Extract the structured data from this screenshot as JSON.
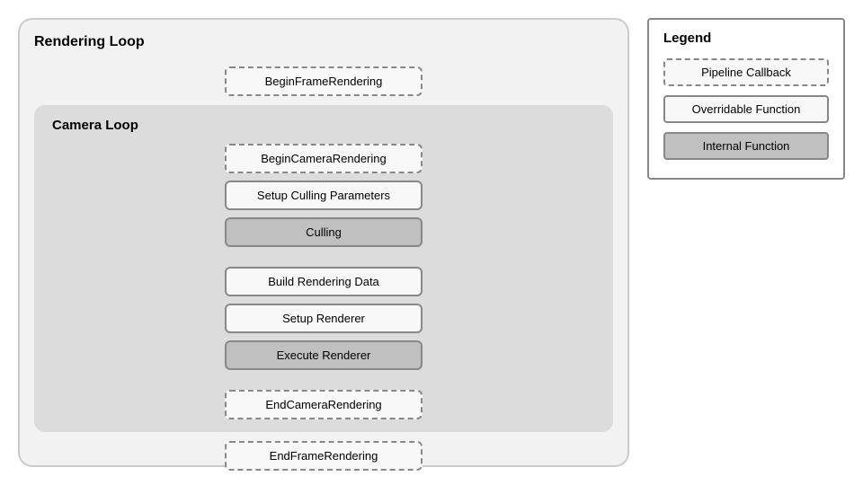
{
  "rendering_loop": {
    "title": "Rendering Loop",
    "begin_frame": "BeginFrameRendering",
    "end_frame": "EndFrameRendering"
  },
  "camera_loop": {
    "title": "Camera Loop",
    "begin_camera": "BeginCameraRendering",
    "setup_culling": "Setup Culling Parameters",
    "culling": "Culling",
    "build_rendering": "Build Rendering Data",
    "setup_renderer": "Setup Renderer",
    "execute_renderer": "Execute Renderer",
    "end_camera": "EndCameraRendering"
  },
  "legend": {
    "title": "Legend",
    "pipeline_callback": "Pipeline Callback",
    "overridable_function": "Overridable Function",
    "internal_function": "Internal Function"
  }
}
